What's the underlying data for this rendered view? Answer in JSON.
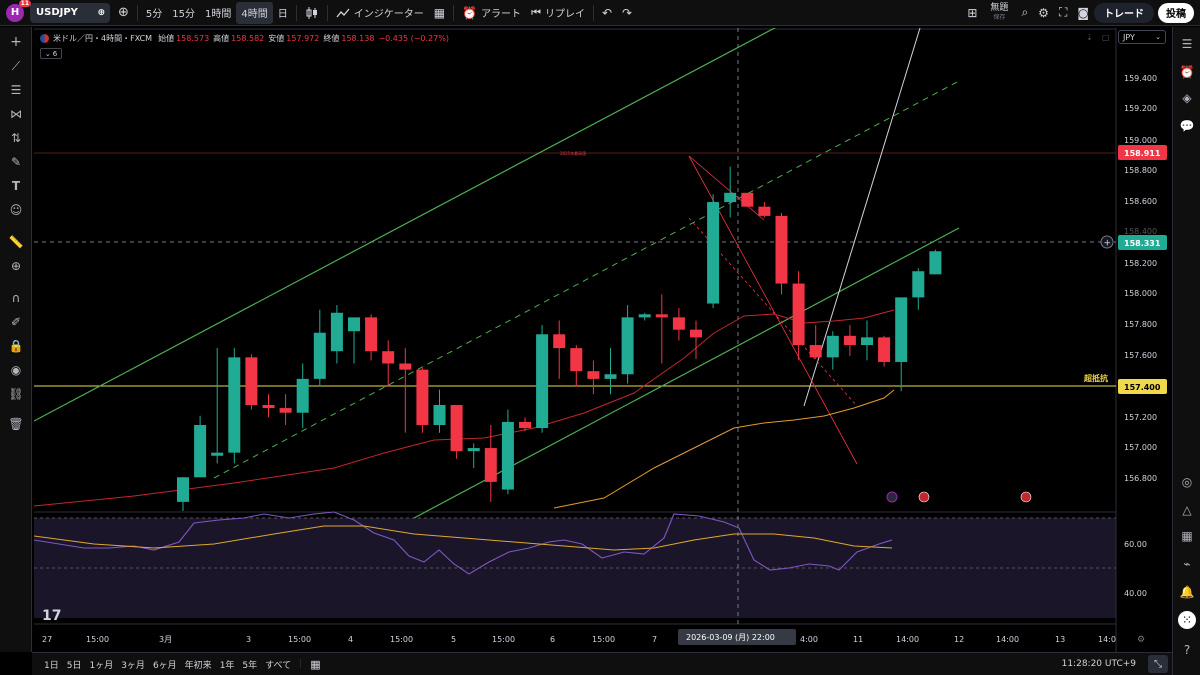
{
  "topbar": {
    "logo_letter": "H",
    "logo_badge": "11",
    "symbol": "USDJPY",
    "intervals": [
      "5分",
      "15分",
      "1時間",
      "4時間",
      "日"
    ],
    "active_interval": "4時間",
    "indicators_label": "インジケーター",
    "alert_label": "アラート",
    "replay_label": "リプレイ",
    "save_title": "無題",
    "save_sub": "保存",
    "trade_label": "トレード",
    "post_label": "投稿"
  },
  "legend": {
    "title": "米ドル／円・4時間・FXCM",
    "open_label": "始値",
    "open": "158.573",
    "high_label": "高値",
    "high": "158.582",
    "low_label": "安値",
    "low": "157.972",
    "close_label": "終値",
    "close": "158.138",
    "change": "−0.435 (−0.27%)",
    "indicator_count": "6"
  },
  "currency": "JPY",
  "price_scale": {
    "ticks": [
      "159.400",
      "159.200",
      "159.000",
      "158.800",
      "158.600",
      "158.200",
      "158.000",
      "157.800",
      "157.600",
      "157.200",
      "157.000",
      "156.800"
    ],
    "partial_tick": "158.400",
    "resistance_price": "158.911",
    "current_price": "158.331",
    "support_price": "157.400"
  },
  "rsi_scale": {
    "ticks": [
      "60.00",
      "40.00"
    ]
  },
  "annotations": {
    "resistance_text": "2025年最高値",
    "support_text": "超抵抗"
  },
  "time_axis": {
    "labels": [
      "27",
      "15:00",
      "3月",
      "3",
      "15:00",
      "4",
      "15:00",
      "5",
      "15:00",
      "6",
      "15:00",
      "7",
      "4:00",
      "11",
      "14:00",
      "12",
      "14:00",
      "13",
      "14:0"
    ],
    "crosshair_label": "2026-03-09 (月)   22:00"
  },
  "bottombar": {
    "ranges": [
      "1日",
      "5日",
      "1ヶ月",
      "3ヶ月",
      "6ヶ月",
      "年初来",
      "1年",
      "5年",
      "すべて"
    ],
    "clock": "11:28:20 UTC+9"
  },
  "watermark": "17",
  "chart_data": {
    "type": "candlestick",
    "symbol": "USDJPY",
    "timeframe": "4h",
    "ylim": [
      156.7,
      159.5
    ],
    "candles": [
      {
        "o": 156.7,
        "h": 156.86,
        "l": 156.6,
        "c": 156.86
      },
      {
        "o": 156.86,
        "h": 157.26,
        "l": 156.86,
        "c": 157.2
      },
      {
        "o": 157.0,
        "h": 157.7,
        "l": 156.95,
        "c": 157.02
      },
      {
        "o": 157.02,
        "h": 157.7,
        "l": 156.95,
        "c": 157.64
      },
      {
        "o": 157.64,
        "h": 157.66,
        "l": 157.3,
        "c": 157.33
      },
      {
        "o": 157.33,
        "h": 157.4,
        "l": 157.25,
        "c": 157.31
      },
      {
        "o": 157.31,
        "h": 157.4,
        "l": 157.2,
        "c": 157.28
      },
      {
        "o": 157.28,
        "h": 157.6,
        "l": 157.18,
        "c": 157.5
      },
      {
        "o": 157.5,
        "h": 157.95,
        "l": 157.45,
        "c": 157.8
      },
      {
        "o": 157.68,
        "h": 157.98,
        "l": 157.6,
        "c": 157.93
      },
      {
        "o": 157.81,
        "h": 157.9,
        "l": 157.6,
        "c": 157.9
      },
      {
        "o": 157.9,
        "h": 157.92,
        "l": 157.62,
        "c": 157.68
      },
      {
        "o": 157.68,
        "h": 157.75,
        "l": 157.45,
        "c": 157.6
      },
      {
        "o": 157.6,
        "h": 157.7,
        "l": 157.15,
        "c": 157.56
      },
      {
        "o": 157.56,
        "h": 157.57,
        "l": 157.15,
        "c": 157.2
      },
      {
        "o": 157.2,
        "h": 157.43,
        "l": 157.15,
        "c": 157.33
      },
      {
        "o": 157.33,
        "h": 157.33,
        "l": 156.98,
        "c": 157.03
      },
      {
        "o": 157.03,
        "h": 157.08,
        "l": 156.92,
        "c": 157.05
      },
      {
        "o": 157.05,
        "h": 157.2,
        "l": 156.7,
        "c": 156.83
      },
      {
        "o": 156.78,
        "h": 157.3,
        "l": 156.75,
        "c": 157.22
      },
      {
        "o": 157.22,
        "h": 157.25,
        "l": 157.16,
        "c": 157.18
      },
      {
        "o": 157.18,
        "h": 157.85,
        "l": 157.15,
        "c": 157.79
      },
      {
        "o": 157.79,
        "h": 157.88,
        "l": 157.5,
        "c": 157.7
      },
      {
        "o": 157.7,
        "h": 157.72,
        "l": 157.45,
        "c": 157.55
      },
      {
        "o": 157.55,
        "h": 157.62,
        "l": 157.4,
        "c": 157.5
      },
      {
        "o": 157.5,
        "h": 157.7,
        "l": 157.4,
        "c": 157.53
      },
      {
        "o": 157.53,
        "h": 157.98,
        "l": 157.47,
        "c": 157.9
      },
      {
        "o": 157.9,
        "h": 157.93,
        "l": 157.88,
        "c": 157.92
      },
      {
        "o": 157.92,
        "h": 158.05,
        "l": 157.6,
        "c": 157.9
      },
      {
        "o": 157.9,
        "h": 157.96,
        "l": 157.75,
        "c": 157.82
      },
      {
        "o": 157.82,
        "h": 157.88,
        "l": 157.63,
        "c": 157.77
      },
      {
        "o": 157.99,
        "h": 158.7,
        "l": 157.96,
        "c": 158.65
      },
      {
        "o": 158.65,
        "h": 158.88,
        "l": 158.55,
        "c": 158.71
      },
      {
        "o": 158.71,
        "h": 158.71,
        "l": 158.62,
        "c": 158.62
      },
      {
        "o": 158.62,
        "h": 158.65,
        "l": 158.55,
        "c": 158.56
      },
      {
        "o": 158.56,
        "h": 158.58,
        "l": 158.05,
        "c": 158.12
      },
      {
        "o": 158.12,
        "h": 158.2,
        "l": 157.62,
        "c": 157.72
      },
      {
        "o": 157.72,
        "h": 157.85,
        "l": 157.63,
        "c": 157.64
      },
      {
        "o": 157.64,
        "h": 157.81,
        "l": 157.56,
        "c": 157.78
      },
      {
        "o": 157.78,
        "h": 157.85,
        "l": 157.65,
        "c": 157.72
      },
      {
        "o": 157.72,
        "h": 157.88,
        "l": 157.62,
        "c": 157.77
      },
      {
        "o": 157.77,
        "h": 157.78,
        "l": 157.58,
        "c": 157.61
      },
      {
        "o": 157.61,
        "h": 158.0,
        "l": 157.42,
        "c": 158.03
      },
      {
        "o": 158.03,
        "h": 158.22,
        "l": 157.95,
        "c": 158.2
      },
      {
        "o": 158.18,
        "h": 158.34,
        "l": 158.18,
        "c": 158.33
      }
    ]
  }
}
